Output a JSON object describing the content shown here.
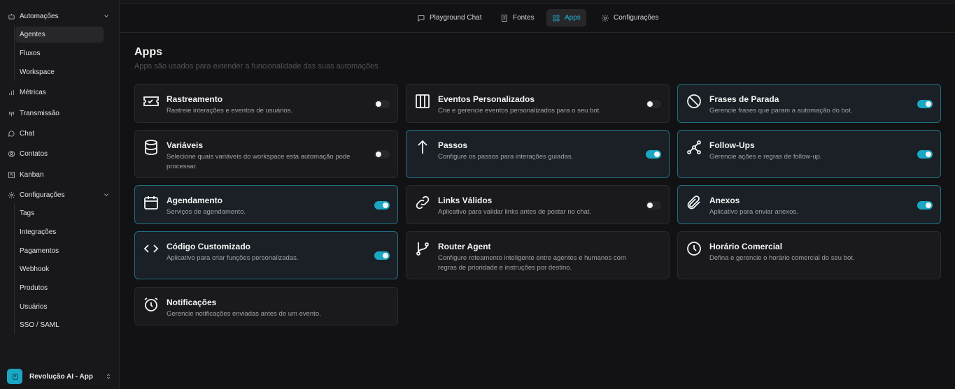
{
  "sidebar": {
    "sections": [
      {
        "label": "Automações",
        "icon": "bot-icon",
        "expanded": true,
        "children": [
          "Agentes",
          "Fluxos",
          "Workspace"
        ],
        "active_child": "Agentes"
      },
      {
        "label": "Métricas",
        "icon": "bar-chart-icon"
      },
      {
        "label": "Transmissão",
        "icon": "broadcast-icon"
      },
      {
        "label": "Chat",
        "icon": "chat-bubble-icon"
      },
      {
        "label": "Contatos",
        "icon": "user-circle-icon"
      },
      {
        "label": "Kanban",
        "icon": "kanban-icon"
      },
      {
        "label": "Configurações",
        "icon": "gear-icon",
        "expanded": true,
        "children": [
          "Tags",
          "Integrações",
          "Pagamentos",
          "Webhook",
          "Produtos",
          "Usuários",
          "SSO / SAML"
        ]
      }
    ],
    "workspace": {
      "name": "Revolução AI - App",
      "icon": "book-icon"
    }
  },
  "tabs": [
    {
      "label": "Playground Chat",
      "icon": "message-square-icon",
      "active": false
    },
    {
      "label": "Fontes",
      "icon": "book-open-icon",
      "active": false
    },
    {
      "label": "Apps",
      "icon": "grid-icon",
      "active": true
    },
    {
      "label": "Configurações",
      "icon": "gear-icon",
      "active": false
    }
  ],
  "main": {
    "title": "Apps",
    "subtitle": "Apps são usados para extender a funcionalidade das suas automações",
    "apps": [
      {
        "title": "Rastreamento",
        "desc": "Rastreie interações e eventos de usuários.",
        "icon": "ticket-icon",
        "enabled": false
      },
      {
        "title": "Eventos Personalizados",
        "desc": "Crie e gerencie eventos personalizados para o seu bot.",
        "icon": "columns-icon",
        "enabled": false
      },
      {
        "title": "Frases de Parada",
        "desc": "Gerencie frases que param a automação do bot.",
        "icon": "ban-icon",
        "enabled": true
      },
      {
        "title": "Variáveis",
        "desc": "Selecione quais variáveis do workspace esta automação pode processar.",
        "icon": "database-icon",
        "enabled": false
      },
      {
        "title": "Passos",
        "desc": "Configure os passos para interações guiadas.",
        "icon": "arrow-up-icon",
        "enabled": true
      },
      {
        "title": "Follow-Ups",
        "desc": "Gerencie ações e regras de follow-up.",
        "icon": "workflow-icon",
        "enabled": true
      },
      {
        "title": "Agendamento",
        "desc": "Serviços de agendamento.",
        "icon": "calendar-icon",
        "enabled": true
      },
      {
        "title": "Links Válidos",
        "desc": "Aplicativo para validar links antes de postar no chat.",
        "icon": "link-icon",
        "enabled": false
      },
      {
        "title": "Anexos",
        "desc": "Aplicativo para enviar anexos.",
        "icon": "paperclip-icon",
        "enabled": true
      },
      {
        "title": "Código Customizado",
        "desc": "Aplicativo para criar funções personalizadas.",
        "icon": "code-icon",
        "enabled": true
      },
      {
        "title": "Router Agent",
        "desc": "Configure roteamento inteligente entre agentes e humanos com regras de prioridade e instruções por destino.",
        "icon": "git-branch-icon",
        "enabled": null
      },
      {
        "title": "Horário Comercial",
        "desc": "Defina e gerencie o horário comercial do seu bot.",
        "icon": "clock-icon",
        "enabled": null
      },
      {
        "title": "Notificações",
        "desc": "Gerencie notificações enviadas antes de um evento.",
        "icon": "alarm-clock-icon",
        "enabled": null
      }
    ]
  },
  "colors": {
    "accent": "#1aa7c4",
    "background": "#121214",
    "card_on_border": "#1f6f80"
  }
}
